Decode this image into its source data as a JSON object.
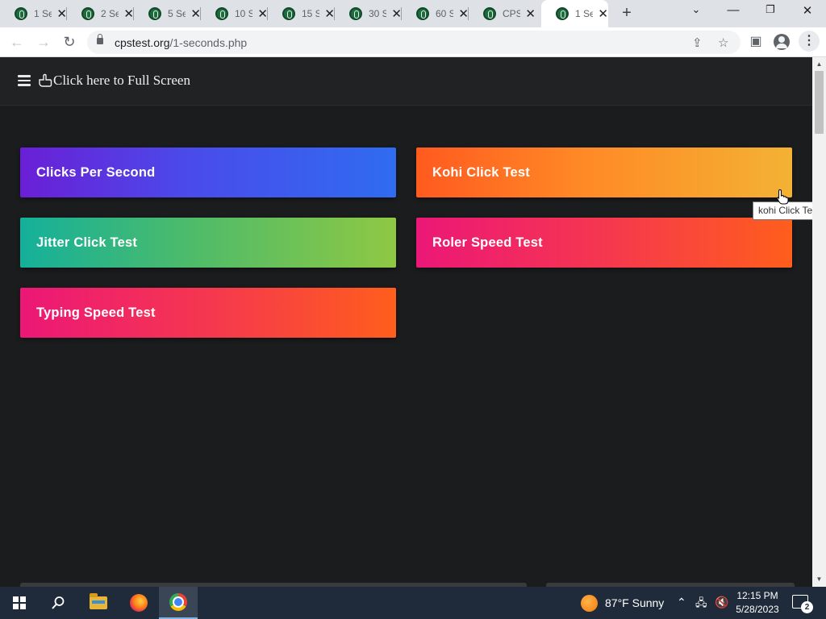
{
  "browser": {
    "tabs": [
      {
        "title": "1 Se",
        "active": false
      },
      {
        "title": "2 Se",
        "active": false
      },
      {
        "title": "5 Se",
        "active": false
      },
      {
        "title": "10 S",
        "active": false
      },
      {
        "title": "15 S",
        "active": false
      },
      {
        "title": "30 S",
        "active": false
      },
      {
        "title": "60 S",
        "active": false
      },
      {
        "title": "CPS",
        "active": false
      },
      {
        "title": "1 Se",
        "active": true
      }
    ],
    "url_domain": "cpstest.org",
    "url_path": "/1-seconds.php"
  },
  "page": {
    "fullscreen_link": "Click here to Full Screen",
    "cards": {
      "cps": "Clicks Per Second",
      "kohi": "Kohi Click Test",
      "jitter": "Jitter Click Test",
      "roler": "Roler Speed Test",
      "typing": "Typing Speed Test"
    },
    "tooltip": "kohi Click Test"
  },
  "taskbar": {
    "weather": "87°F  Sunny",
    "time": "12:15 PM",
    "date": "5/28/2023",
    "notification_count": "2"
  },
  "colors": {
    "page_bg": "#1b1c1e",
    "header_bg": "#212224",
    "taskbar_bg": "#1f2b3a"
  }
}
